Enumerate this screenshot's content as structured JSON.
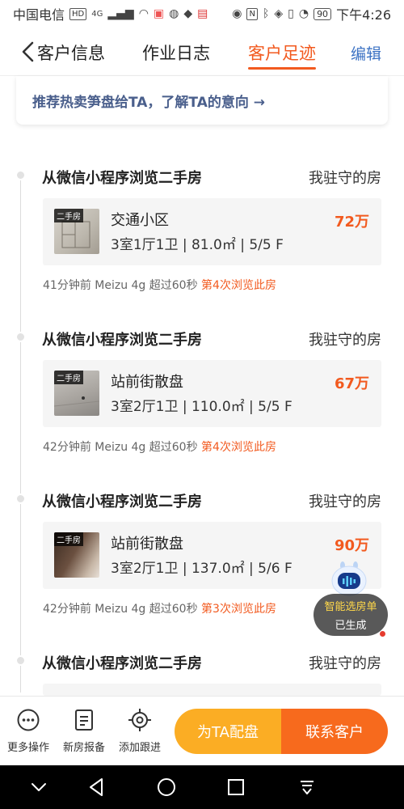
{
  "status_bar": {
    "carrier": "中国电信",
    "hd_badge": "HD",
    "network": "4G",
    "nfc_badge": "N",
    "battery": "90",
    "time": "下午4:26"
  },
  "nav": {
    "tabs": [
      {
        "label": "客户信息"
      },
      {
        "label": "作业日志"
      },
      {
        "label": "客户足迹"
      }
    ],
    "active_tab": "客户足迹",
    "edit_label": "编辑"
  },
  "recommend": {
    "text": "推荐热卖笋盘给TA，了解TA的意向 →"
  },
  "footprints": [
    {
      "title": "从微信小程序浏览二手房",
      "tag": "我驻守的房",
      "badge": "二手房",
      "name": "交通小区",
      "spec": "3室1厅1卫 | 81.0㎡ | 5/5 F",
      "price": "72万",
      "meta": "41分钟前 Meizu 4g 超过60秒",
      "visit": "第4次浏览此房"
    },
    {
      "title": "从微信小程序浏览二手房",
      "tag": "我驻守的房",
      "badge": "二手房",
      "name": "站前街散盘",
      "spec": "3室2厅1卫 | 110.0㎡ | 5/5 F",
      "price": "67万",
      "meta": "42分钟前 Meizu 4g 超过60秒",
      "visit": "第4次浏览此房"
    },
    {
      "title": "从微信小程序浏览二手房",
      "tag": "我驻守的房",
      "badge": "二手房",
      "name": "站前街散盘",
      "spec": "3室2厅1卫 | 137.0㎡ | 5/6 F",
      "price": "90万",
      "meta": "42分钟前 Meizu 4g 超过60秒",
      "visit": "第3次浏览此房"
    },
    {
      "title": "从微信小程序浏览二手房",
      "tag": "我驻守的房"
    }
  ],
  "ai_assistant": {
    "line1": "智能选房单",
    "line2": "已生成"
  },
  "bottom_bar": {
    "more_label": "更多操作",
    "report_label": "新房报备",
    "follow_label": "添加跟进",
    "match_label": "为TA配盘",
    "contact_label": "联系客户"
  },
  "colors": {
    "accent": "#f25a1f",
    "link": "#3d73c4",
    "match_button": "#fbad24",
    "contact_button": "#f76a1d"
  },
  "icons": [
    "back-arrow-icon",
    "more-icon",
    "report-icon",
    "follow-icon",
    "robot-icon",
    "sys-back-icon",
    "sys-home-icon",
    "sys-recent-icon",
    "sys-menu-icon"
  ]
}
